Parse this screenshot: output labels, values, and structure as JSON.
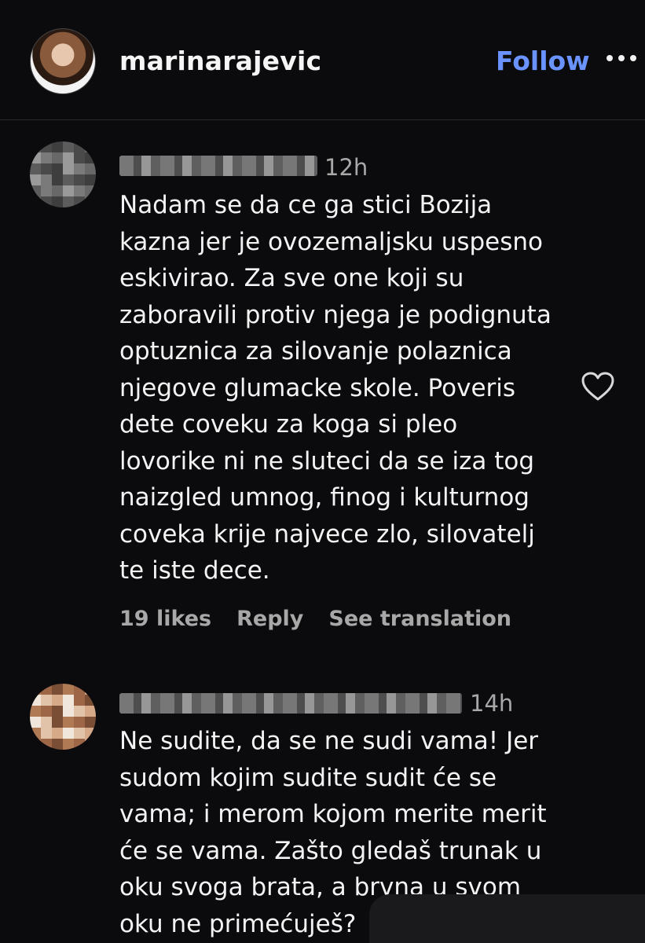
{
  "header": {
    "username": "marinarajevic",
    "follow_label": "Follow",
    "more_icon": "more-horizontal-icon"
  },
  "comments": [
    {
      "time": "12h",
      "text": "Nadam se da ce ga stici Bozija\nkazna jer je ovozemaljsku uspesno\neskivirao. Za sve one koji su\nzaboravili protiv njega je podignuta\noptuznica za silovanje polaznica\nnjegove glumacke skole. Poveris\ndete coveku za koga si pleo\nlovorike ni ne sluteci da se iza tog\nnaizgled umnog, finog i kulturnog\ncoveka krije najvece zlo, silovatelj\nte iste dece.",
      "likes": "19 likes",
      "reply": "Reply",
      "see_translation": "See translation"
    },
    {
      "time": "14h",
      "text": "Ne sudite, da se ne sudi vama! Jer\nsudom kojim sudite sudit će se\nvama; i merom kojom merite merit\nće se vama. Zašto gledaš trunak u\noku svoga brata, a brvna u svom\noku ne primećuješ?"
    }
  ],
  "colors": {
    "background": "#0b0b0d",
    "accent": "#6b93ff",
    "secondary_text": "#a8a8a8"
  }
}
